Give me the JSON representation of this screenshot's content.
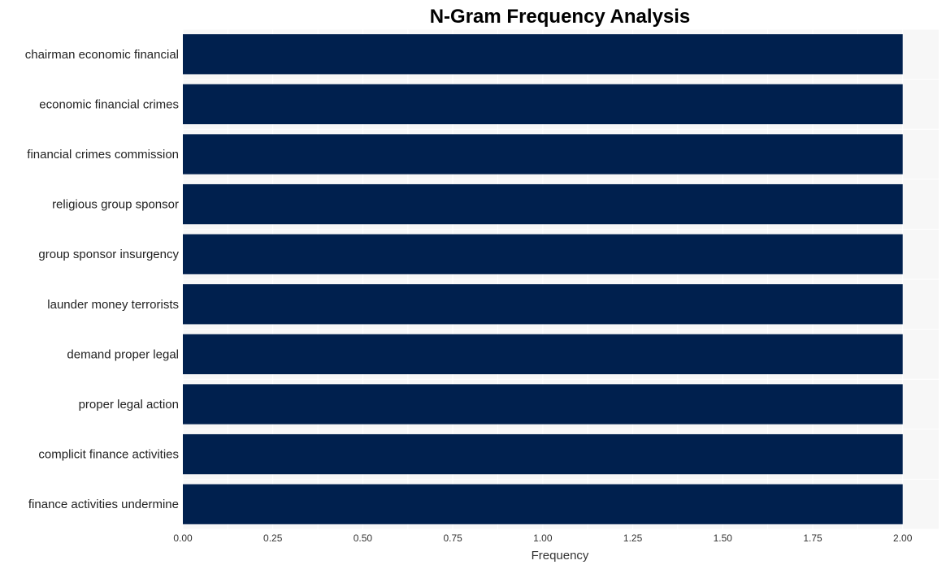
{
  "chart_data": {
    "type": "bar",
    "orientation": "horizontal",
    "title": "N-Gram Frequency Analysis",
    "xlabel": "Frequency",
    "ylabel": "",
    "categories": [
      "chairman economic financial",
      "economic financial crimes",
      "financial crimes commission",
      "religious group sponsor",
      "group sponsor insurgency",
      "launder money terrorists",
      "demand proper legal",
      "proper legal action",
      "complicit finance activities",
      "finance activities undermine"
    ],
    "values": [
      2,
      2,
      2,
      2,
      2,
      2,
      2,
      2,
      2,
      2
    ],
    "xlim": [
      0,
      2.1
    ],
    "xticks": [
      "0.00",
      "0.25",
      "0.50",
      "0.75",
      "1.00",
      "1.25",
      "1.50",
      "1.75",
      "2.00"
    ],
    "grid": true,
    "legend": "none",
    "colors": {
      "bar": "#00204e",
      "plot_background": "#f7f7f7",
      "grid": "#ffffff"
    }
  }
}
